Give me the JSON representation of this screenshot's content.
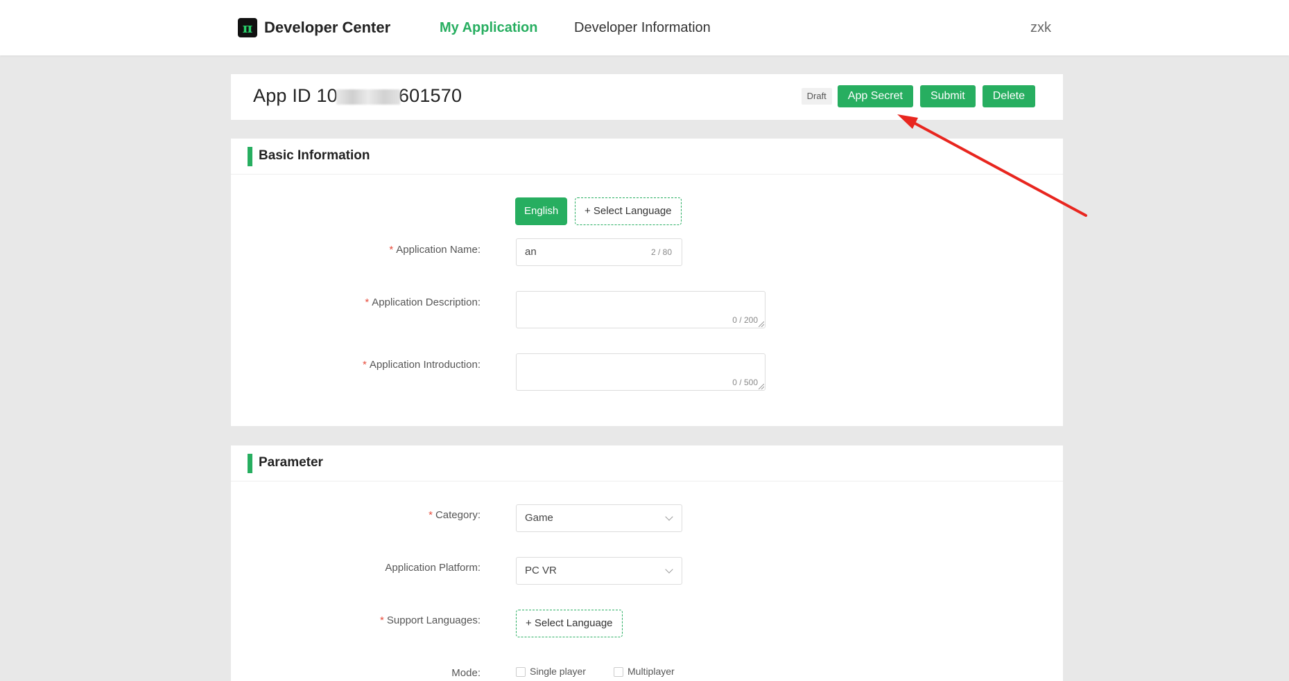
{
  "nav": {
    "brand_logo": "π",
    "brand_title": "Developer Center",
    "items": [
      {
        "label": "My Application",
        "active": true
      },
      {
        "label": "Developer Information",
        "active": false
      }
    ],
    "user": "zxk"
  },
  "app_header": {
    "id_prefix": "App ID 10",
    "id_suffix": "601570",
    "status_badge": "Draft",
    "buttons": {
      "app_secret": "App Secret",
      "submit": "Submit",
      "delete": "Delete"
    }
  },
  "basic_info": {
    "title": "Basic Information",
    "language_tabs": {
      "active": "English",
      "add": "+ Select Language"
    },
    "fields": {
      "app_name": {
        "label": "Application Name:",
        "value": "an",
        "counter": "2 / 80"
      },
      "app_description": {
        "label": "Application Description:",
        "value": "",
        "counter": "0 / 200"
      },
      "app_introduction": {
        "label": "Application Introduction:",
        "value": "",
        "counter": "0 / 500"
      }
    }
  },
  "parameter": {
    "title": "Parameter",
    "fields": {
      "category": {
        "label": "Category:",
        "value": "Game"
      },
      "platform": {
        "label": "Application Platform:",
        "value": "PC VR"
      },
      "support_languages": {
        "label": "Support Languages:",
        "button": "+ Select Language"
      },
      "mode": {
        "label": "Mode:",
        "options": [
          "Single player",
          "Multiplayer"
        ]
      }
    }
  },
  "colors": {
    "accent": "#27ae60",
    "required": "#e74c3c",
    "annotation": "#e8261f"
  }
}
